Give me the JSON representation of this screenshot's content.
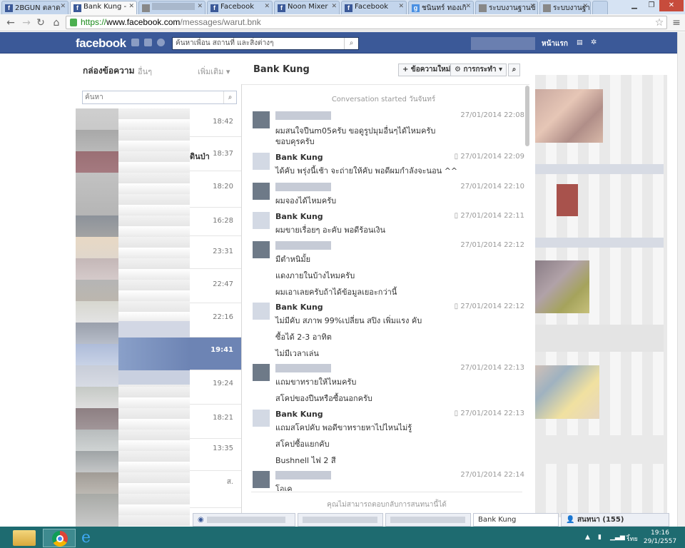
{
  "browser": {
    "tabs": [
      {
        "label": "2BGUN ตลาด",
        "icon": "facebook-icon"
      },
      {
        "label": "Bank Kung -",
        "icon": "facebook-icon",
        "active": true
      },
      {
        "label": "",
        "icon": "blurred-icon"
      },
      {
        "label": "Facebook",
        "icon": "facebook-icon"
      },
      {
        "label": "Noon Mixer",
        "icon": "facebook-icon"
      },
      {
        "label": "Facebook",
        "icon": "facebook-icon"
      },
      {
        "label": "ชนินทร์ ทองเกิ",
        "icon": "google-icon"
      },
      {
        "label": "ระบบงานฐานข้",
        "icon": "document-icon"
      },
      {
        "label": "ระบบงานฐานข้",
        "icon": "document-icon"
      }
    ],
    "url": {
      "scheme": "https://",
      "domain": "www.facebook.com",
      "path": "/messages/warut.bnk"
    }
  },
  "facebook": {
    "logo": "facebook",
    "search_placeholder": "ค้นหาเพื่อน สถานที่ และสิ่งต่างๆ",
    "home_label": "หน้าแรก",
    "brand_color": "#3b5998"
  },
  "sidebar": {
    "inbox_label": "กล่องข้อความ",
    "other_label": "อื่นๆ",
    "more_label": "เพิ่มเติม ▾",
    "search_placeholder": "ค้นหา",
    "conversations": [
      {
        "time": "18:42",
        "snippet": ""
      },
      {
        "time": "18:37",
        "snippet": "ดินป่า"
      },
      {
        "time": "18:20",
        "snippet": ""
      },
      {
        "time": "16:28",
        "snippet": ""
      },
      {
        "time": "23:31",
        "snippet": ""
      },
      {
        "time": "22:47",
        "snippet": ""
      },
      {
        "time": "22:16",
        "snippet": ""
      },
      {
        "time": "19:41",
        "snippet": "",
        "selected": true
      },
      {
        "time": "19:24",
        "snippet": ""
      },
      {
        "time": "18:21",
        "snippet": ""
      },
      {
        "time": "13:35",
        "snippet": ""
      },
      {
        "time": "ส.",
        "snippet": ""
      }
    ]
  },
  "conversation": {
    "title": "Bank Kung",
    "new_message_button": "+ ข้อความใหม่",
    "actions_button": "⚙ การกระทำ ▾",
    "search_icon": "search-icon",
    "started": "Conversation started วันจันทร์",
    "messages": [
      {
        "sender": "",
        "own": false,
        "time": "27/01/2014 22:08",
        "lines": [
          "ผมสนใจปืนm05ครับ ขอดูรูปมุมอื่นๆได้ไหมครับ",
          "ขอบคุรครับ"
        ]
      },
      {
        "sender": "Bank Kung",
        "own": true,
        "time": "27/01/2014 22:09",
        "lines": [
          "ได้คับ พรุ่งนี้เช้า จะถ่ายให้คับ พอดีผมกำลังจะนอน ^^"
        ]
      },
      {
        "sender": "",
        "own": false,
        "time": "27/01/2014 22:10",
        "lines": [
          "ผมจองได้ไหมครับ"
        ]
      },
      {
        "sender": "Bank Kung",
        "own": true,
        "time": "27/01/2014 22:11",
        "lines": [
          "ผมขายเรื่อยๆ อะคับ พอดีร้อนเงิน"
        ]
      },
      {
        "sender": "",
        "own": false,
        "time": "27/01/2014 22:12",
        "lines": [
          "มีตำหนิมั้ย",
          "แดงภายในบ้างไหมครับ",
          "ผมเอาเลยครับถ้าได้ข้อมูลเยอะกว่านี้"
        ]
      },
      {
        "sender": "Bank Kung",
        "own": true,
        "time": "27/01/2014 22:12",
        "lines": [
          "ไม่มีคับ สภาพ 99%เปลี่ยน สปิง เพิ่มแรง คับ",
          "ซื้อได้ 2-3 อาทิต",
          "ไม่มีเวลาเล่น"
        ]
      },
      {
        "sender": "",
        "own": false,
        "time": "27/01/2014 22:13",
        "lines": [
          "แถมขาทรายให้ไหมครับ",
          "สโคปของปืนหรือซื้อนอกครับ"
        ]
      },
      {
        "sender": "Bank Kung",
        "own": true,
        "time": "27/01/2014 22:13",
        "lines": [
          "แถมสโคปคับ พอดีขาทรายหาไปไหนไม่รู้",
          "สโคปซื้อแยกคับ",
          "Bushnell ไฟ 2 สี"
        ]
      },
      {
        "sender": "",
        "own": false,
        "time": "27/01/2014 22:14",
        "lines": [
          "โอเค"
        ]
      }
    ],
    "reply_note": "คุณไม่สามารถตอบกลับการสนทนานี้ได้"
  },
  "chat_dock": {
    "tab_bank": "Bank Kung",
    "online_label": "สนทนา (155)"
  },
  "taskbar": {
    "language": "ไทย",
    "time": "19:16",
    "date": "29/1/2557"
  }
}
